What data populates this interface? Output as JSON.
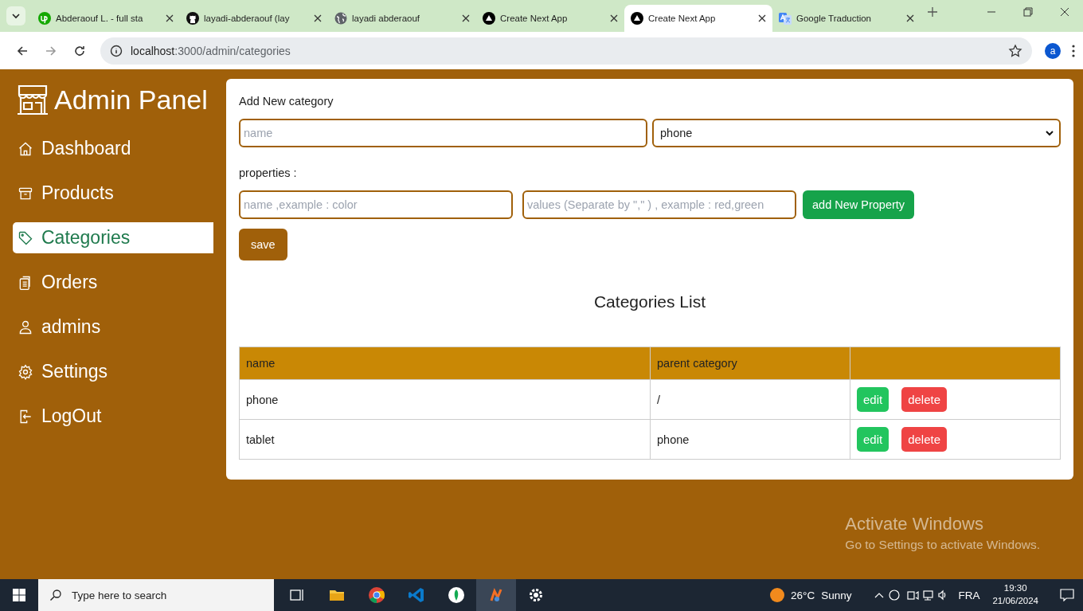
{
  "browser": {
    "tabs": [
      {
        "title": "Abderaouf L. - full sta",
        "kind": "upwork",
        "selected": false
      },
      {
        "title": "layadi-abderaouf (lay",
        "kind": "github",
        "selected": false
      },
      {
        "title": "layadi abderaouf",
        "kind": "globe",
        "selected": false
      },
      {
        "title": "Create Next App",
        "kind": "triangle",
        "selected": false
      },
      {
        "title": "Create Next App",
        "kind": "triangle",
        "selected": true
      },
      {
        "title": "Google Traduction",
        "kind": "translate",
        "selected": false
      }
    ],
    "url_host": "localhost",
    "url_path": ":3000/admin/categories",
    "profile": "a"
  },
  "sidebar": {
    "title": "Admin Panel",
    "items": [
      {
        "label": "Dashboard",
        "kind": "home",
        "selected": false
      },
      {
        "label": "Products",
        "kind": "archive",
        "selected": false
      },
      {
        "label": "Categories",
        "kind": "tag",
        "selected": true
      },
      {
        "label": "Orders",
        "kind": "clipboard",
        "selected": false
      },
      {
        "label": "admins",
        "kind": "user",
        "selected": false
      },
      {
        "label": "Settings",
        "kind": "gear",
        "selected": false
      },
      {
        "label": "LogOut",
        "kind": "logout",
        "selected": false
      }
    ]
  },
  "form": {
    "heading": "Add New category",
    "name_placeholder": "name",
    "parent_value": "phone",
    "properties_label": "properties :",
    "property_name_placeholder": "name ,example : color",
    "property_values_placeholder": "values (Separate by \",\" ) , example : red,green",
    "add_property_button": "add New Property",
    "save_button": "save"
  },
  "list": {
    "title": "Categories List",
    "columns": [
      "name",
      "parent category"
    ],
    "rows": [
      {
        "cells": [
          "phone",
          "/"
        ],
        "actions": [
          "edit",
          "delete"
        ]
      },
      {
        "cells": [
          "tablet",
          "phone"
        ],
        "actions": [
          "edit",
          "delete"
        ]
      }
    ]
  },
  "watermark_os": {
    "title": "Activate Windows",
    "subtitle": "Go to Settings to activate Windows."
  },
  "taskbar": {
    "search_placeholder": "Type here to search",
    "temperature": "26°C",
    "weather": "Sunny",
    "language": "FRA",
    "time": "19:30",
    "date": "21/06/2024"
  }
}
